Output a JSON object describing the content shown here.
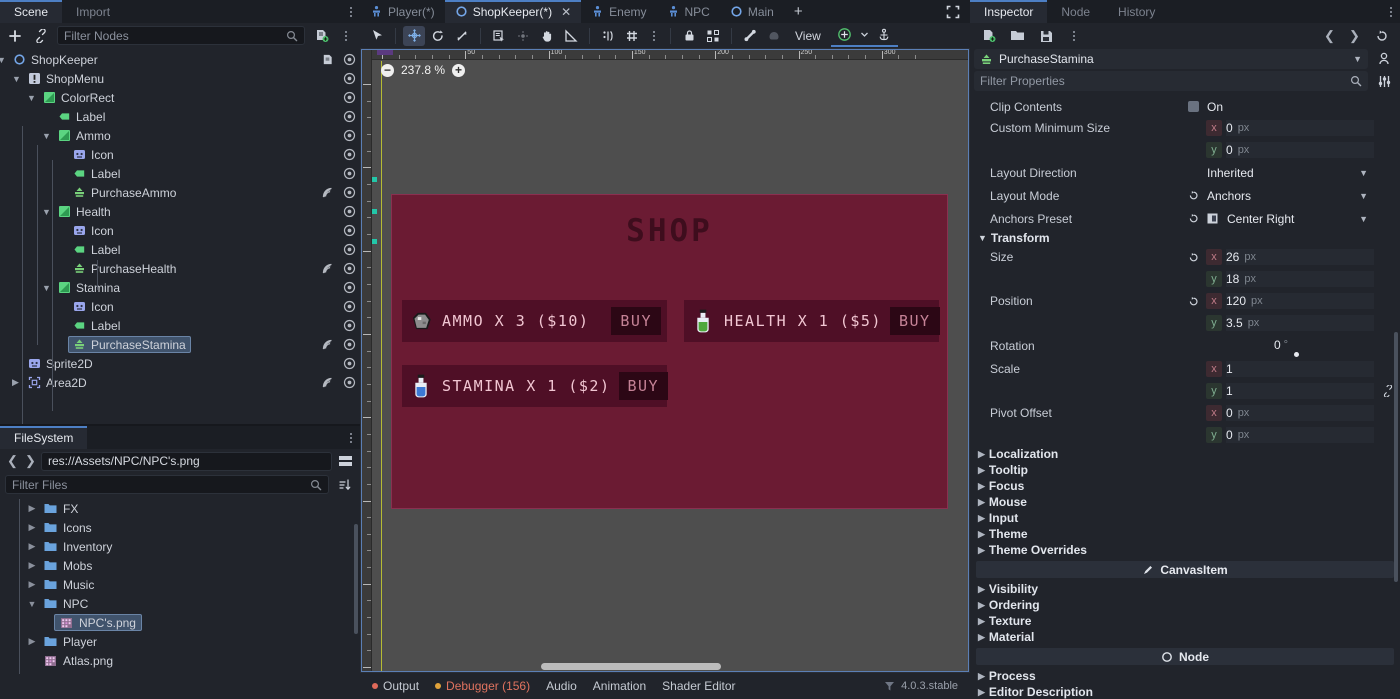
{
  "left_panel": {
    "tabs": [
      {
        "label": "Scene",
        "active": true
      },
      {
        "label": "Import",
        "active": false
      }
    ],
    "filter_placeholder": "Filter Nodes",
    "tree": [
      {
        "label": "ShopKeeper",
        "depth": 0,
        "icon": "node2d-icon",
        "expander": "down",
        "script": true,
        "eye": true,
        "signal": false,
        "selected": false
      },
      {
        "label": "ShopMenu",
        "depth": 1,
        "icon": "canvaslayer-icon",
        "expander": "down",
        "script": false,
        "eye": true,
        "signal": false,
        "selected": false
      },
      {
        "label": "ColorRect",
        "depth": 2,
        "icon": "colorrect-icon",
        "expander": "down",
        "script": false,
        "eye": true,
        "signal": false,
        "selected": false
      },
      {
        "label": "Label",
        "depth": 3,
        "icon": "label-icon",
        "expander": "none",
        "script": false,
        "eye": true,
        "signal": false,
        "selected": false
      },
      {
        "label": "Ammo",
        "depth": 3,
        "icon": "colorrect-icon",
        "expander": "down",
        "script": false,
        "eye": true,
        "signal": false,
        "selected": false
      },
      {
        "label": "Icon",
        "depth": 4,
        "icon": "texturerect-icon",
        "expander": "none",
        "script": false,
        "eye": true,
        "signal": false,
        "selected": false
      },
      {
        "label": "Label",
        "depth": 4,
        "icon": "label-icon",
        "expander": "none",
        "script": false,
        "eye": true,
        "signal": false,
        "selected": false
      },
      {
        "label": "PurchaseAmmo",
        "depth": 4,
        "icon": "button-icon",
        "expander": "none",
        "script": false,
        "eye": true,
        "signal": true,
        "selected": false
      },
      {
        "label": "Health",
        "depth": 3,
        "icon": "colorrect-icon",
        "expander": "down",
        "script": false,
        "eye": true,
        "signal": false,
        "selected": false
      },
      {
        "label": "Icon",
        "depth": 4,
        "icon": "texturerect-icon",
        "expander": "none",
        "script": false,
        "eye": true,
        "signal": false,
        "selected": false
      },
      {
        "label": "Label",
        "depth": 4,
        "icon": "label-icon",
        "expander": "none",
        "script": false,
        "eye": true,
        "signal": false,
        "selected": false
      },
      {
        "label": "PurchaseHealth",
        "depth": 4,
        "icon": "button-icon",
        "expander": "none",
        "script": false,
        "eye": true,
        "signal": true,
        "selected": false
      },
      {
        "label": "Stamina",
        "depth": 3,
        "icon": "colorrect-icon",
        "expander": "down",
        "script": false,
        "eye": true,
        "signal": false,
        "selected": false
      },
      {
        "label": "Icon",
        "depth": 4,
        "icon": "texturerect-icon",
        "expander": "none",
        "script": false,
        "eye": true,
        "signal": false,
        "selected": false
      },
      {
        "label": "Label",
        "depth": 4,
        "icon": "label-icon",
        "expander": "none",
        "script": false,
        "eye": true,
        "signal": false,
        "selected": false
      },
      {
        "label": "PurchaseStamina",
        "depth": 4,
        "icon": "button-icon",
        "expander": "none",
        "script": false,
        "eye": true,
        "signal": true,
        "selected": true
      },
      {
        "label": "Sprite2D",
        "depth": 1,
        "icon": "texturerect-icon",
        "expander": "none",
        "script": false,
        "eye": true,
        "signal": false,
        "selected": false
      },
      {
        "label": "Area2D",
        "depth": 1,
        "icon": "area2d-icon",
        "expander": "right",
        "script": false,
        "eye": true,
        "signal": true,
        "selected": false
      }
    ]
  },
  "filesystem": {
    "tab_label": "FileSystem",
    "path": "res://Assets/NPC/NPC's.png",
    "filter_placeholder": "Filter Files",
    "items": [
      {
        "label": "FX",
        "type": "folder",
        "depth": 1,
        "chev": "right",
        "selected": false
      },
      {
        "label": "Icons",
        "type": "folder",
        "depth": 1,
        "chev": "right",
        "selected": false
      },
      {
        "label": "Inventory",
        "type": "folder",
        "depth": 1,
        "chev": "right",
        "selected": false
      },
      {
        "label": "Mobs",
        "type": "folder",
        "depth": 1,
        "chev": "right",
        "selected": false
      },
      {
        "label": "Music",
        "type": "folder",
        "depth": 1,
        "chev": "right",
        "selected": false
      },
      {
        "label": "NPC",
        "type": "folder",
        "depth": 1,
        "chev": "down",
        "selected": false
      },
      {
        "label": "NPC's.png",
        "type": "image",
        "depth": 2,
        "chev": "none",
        "selected": true
      },
      {
        "label": "Player",
        "type": "folder",
        "depth": 1,
        "chev": "right",
        "selected": false
      },
      {
        "label": "Atlas.png",
        "type": "image",
        "depth": 1,
        "chev": "none",
        "selected": false
      }
    ]
  },
  "scene_tabs": {
    "tabs": [
      {
        "label": "Player(*)",
        "icon": "character-icon",
        "active": false,
        "closable": false
      },
      {
        "label": "ShopKeeper(*)",
        "icon": "node2d-icon",
        "active": true,
        "closable": true
      },
      {
        "label": "Enemy",
        "icon": "character-icon",
        "active": false,
        "closable": false
      },
      {
        "label": "NPC",
        "icon": "character-icon",
        "active": false,
        "closable": false
      },
      {
        "label": "Main",
        "icon": "node2d-icon",
        "active": false,
        "closable": false
      }
    ],
    "add_label": "+"
  },
  "viewport_toolbar": {
    "view_label": "View",
    "tools": [
      {
        "name": "select-tool-icon",
        "active": false
      },
      {
        "name": "move-tool-icon",
        "active": true
      },
      {
        "name": "rotate-tool-icon",
        "active": false
      },
      {
        "name": "scale-tool-icon",
        "active": false
      },
      {
        "name": "list-select-icon",
        "active": false
      },
      {
        "name": "snap-mode-icon",
        "active": false
      },
      {
        "name": "pan-tool-icon",
        "active": false
      },
      {
        "name": "ruler-tool-icon",
        "active": false
      },
      {
        "name": "smart-snap-icon",
        "active": false
      },
      {
        "name": "grid-snap-icon",
        "active": false
      },
      {
        "name": "snap-options-icon",
        "active": false
      },
      {
        "name": "lock-icon",
        "active": false
      },
      {
        "name": "group-icon",
        "active": false
      },
      {
        "name": "bone-icon",
        "active": false
      },
      {
        "name": "skeleton-options-icon",
        "active": false
      }
    ]
  },
  "viewport": {
    "zoom_level": "237.8 %",
    "zoom_out_label": "−",
    "zoom_in_label": "+",
    "ruler_labels_h": [
      "0",
      "50",
      "100",
      "150",
      "200",
      "250",
      "300"
    ]
  },
  "shop": {
    "title": "SHOP",
    "buy_label": "BUY",
    "items": [
      {
        "name": "AMMO X 3 ($10)",
        "icon": "rock-icon",
        "icon_color": "#9a9a9a"
      },
      {
        "name": "HEALTH X 1 ($5)",
        "icon": "green-potion-icon",
        "icon_color": "#4fa83c"
      },
      {
        "name": "STAMINA X 1 ($2)",
        "icon": "blue-potion-icon",
        "icon_color": "#3c79d4"
      }
    ]
  },
  "bottom_bar": {
    "items": [
      {
        "label": "Output",
        "dot": "#e06a5a",
        "color": "#c5cad2"
      },
      {
        "label": "Debugger (156)",
        "dot": "#e0a23a",
        "color": "#e0735f"
      },
      {
        "label": "Audio",
        "dot": null,
        "color": "#c5cad2"
      },
      {
        "label": "Animation",
        "dot": null,
        "color": "#c5cad2"
      },
      {
        "label": "Shader Editor",
        "dot": null,
        "color": "#c5cad2"
      }
    ],
    "version": "4.0.3.stable"
  },
  "inspector": {
    "tabs": [
      {
        "label": "Inspector",
        "active": true
      },
      {
        "label": "Node",
        "active": false
      },
      {
        "label": "History",
        "active": false
      }
    ],
    "node_name": "PurchaseStamina",
    "filter_placeholder": "Filter Properties",
    "properties": [
      {
        "kind": "bool",
        "label": "Clip Contents",
        "value": "On"
      },
      {
        "kind": "vec2",
        "label": "Custom Minimum Size",
        "x": "0",
        "y": "0",
        "unit": "px",
        "revert": false
      },
      {
        "kind": "enum",
        "label": "Layout Direction",
        "value": "Inherited",
        "revert": false,
        "icon": null
      },
      {
        "kind": "enum",
        "label": "Layout Mode",
        "value": "Anchors",
        "revert": true,
        "icon": null
      },
      {
        "kind": "enum",
        "label": "Anchors Preset",
        "value": "Center Right",
        "revert": true,
        "icon": "anchor-preset-icon"
      },
      {
        "kind": "section",
        "label": "Transform",
        "expanded": true
      },
      {
        "kind": "vec2",
        "label": "Size",
        "x": "26",
        "y": "18",
        "unit": "px",
        "revert": true
      },
      {
        "kind": "vec2",
        "label": "Position",
        "x": "120",
        "y": "3.5",
        "unit": "px",
        "revert": true
      },
      {
        "kind": "slider",
        "label": "Rotation",
        "value": "0",
        "unit": "°"
      },
      {
        "kind": "vec2-link",
        "label": "Scale",
        "x": "1",
        "y": "1",
        "unit": "",
        "revert": false
      },
      {
        "kind": "vec2",
        "label": "Pivot Offset",
        "x": "0",
        "y": "0",
        "unit": "px",
        "revert": false
      },
      {
        "kind": "collapsed",
        "label": "Localization"
      },
      {
        "kind": "collapsed",
        "label": "Tooltip"
      },
      {
        "kind": "collapsed",
        "label": "Focus"
      },
      {
        "kind": "collapsed",
        "label": "Mouse"
      },
      {
        "kind": "collapsed",
        "label": "Input"
      },
      {
        "kind": "collapsed",
        "label": "Theme"
      },
      {
        "kind": "collapsed",
        "label": "Theme Overrides"
      },
      {
        "kind": "category",
        "label": "CanvasItem",
        "icon": "brush-icon"
      },
      {
        "kind": "collapsed",
        "label": "Visibility"
      },
      {
        "kind": "collapsed",
        "label": "Ordering"
      },
      {
        "kind": "collapsed",
        "label": "Texture"
      },
      {
        "kind": "collapsed",
        "label": "Material"
      },
      {
        "kind": "category",
        "label": "Node",
        "icon": "node-circle-icon"
      },
      {
        "kind": "collapsed",
        "label": "Process"
      },
      {
        "kind": "collapsed",
        "label": "Editor Description"
      }
    ]
  },
  "colors": {
    "accent": "#4d7fc4",
    "panel_bg": "#21242b",
    "dark_bg": "#16181d",
    "shop_bg": "#6b1b33",
    "shop_row": "#4f0f26",
    "selection": "#40536c"
  }
}
